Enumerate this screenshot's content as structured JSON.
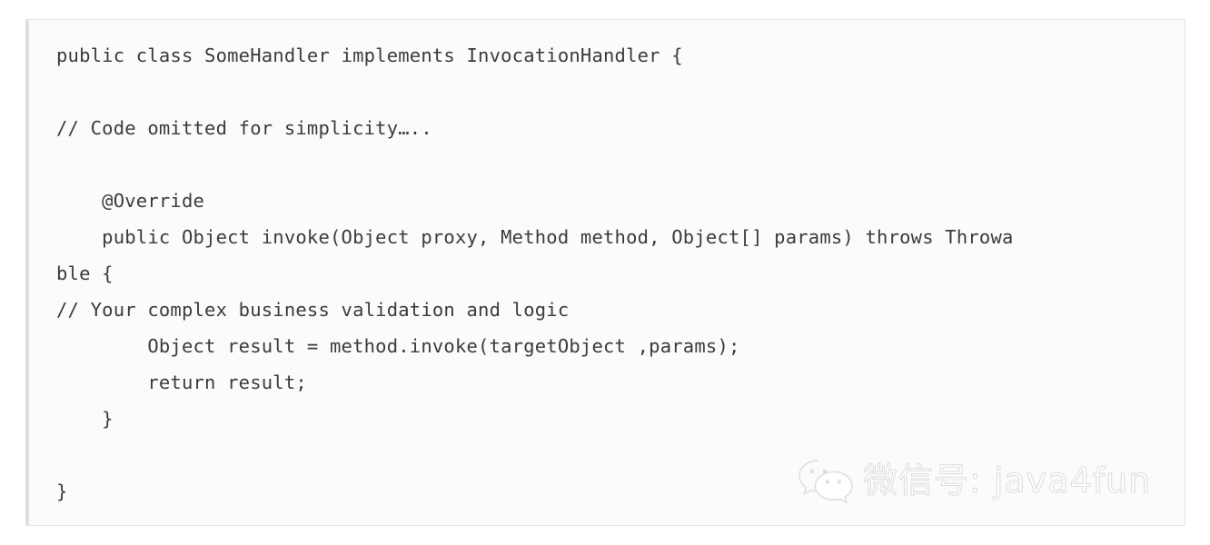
{
  "page": {
    "background_color": "#ffffff"
  },
  "code_panel": {
    "background_color": "#fbfbfb",
    "border_color": "#e4e4e4",
    "accent_bar_color": "#e0e0e0",
    "text_color": "#3b3b3b",
    "language": "java",
    "lines": [
      "public class SomeHandler implements InvocationHandler {",
      "",
      "// Code omitted for simplicity…..",
      "",
      "    @Override",
      "    public Object invoke(Object proxy, Method method, Object[] params) throws Throwa",
      "ble {",
      "// Your complex business validation and logic",
      "        Object result = method.invoke(targetObject ,params);",
      "        return result;",
      "    }",
      "",
      "}"
    ]
  },
  "watermark": {
    "icon": "wechat-logo-icon",
    "text": "微信号: java4fun",
    "color": "#dedede"
  }
}
